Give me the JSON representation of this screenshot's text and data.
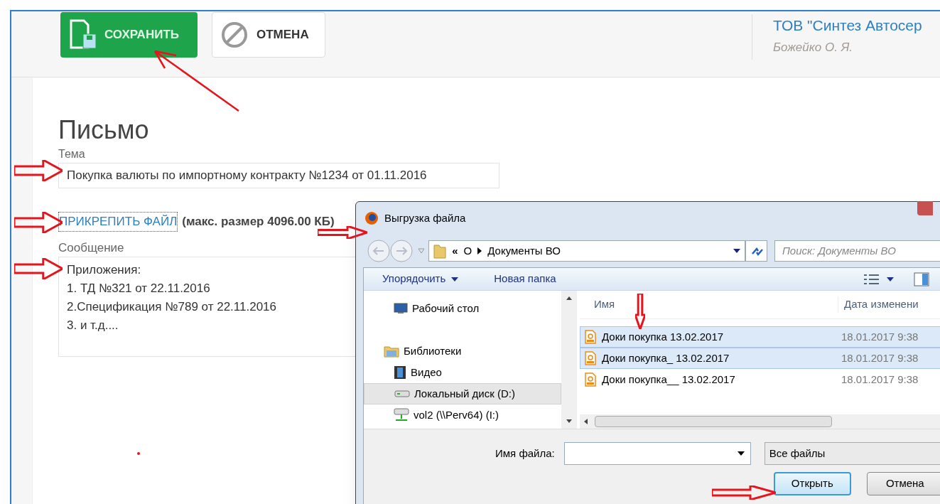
{
  "toolbar": {
    "buttons": [
      {
        "kind": "save",
        "label": "СОХРАНИТЬ"
      },
      {
        "kind": "cancel",
        "label": "ОТМЕНА"
      }
    ]
  },
  "account": {
    "company": "ТОВ \"Синтез Автосер",
    "user": "Божейко О. Я."
  },
  "form": {
    "title": "Письмо",
    "subject_label": "Тема",
    "subject_value": "Покупка валюты по импортному контракту №1234 от 01.11.2016",
    "attach_link": "ПРИКРЕПИТЬ ФАЙЛ",
    "attach_note": "(макс. размер 4096.00 КБ)",
    "message_label": "Сообщение",
    "message_lines": [
      "Приложения:",
      "1. ТД №321 от 22.11.2016",
      "2.Спецификация №789 от 22.11.2016",
      "3. и т.д...."
    ]
  },
  "dialog": {
    "title": "Выгрузка файла",
    "path": [
      "«",
      "О",
      "Документы ВО"
    ],
    "search_placeholder": "Поиск: Документы ВО",
    "commands": [
      "Упорядочить",
      "Новая папка"
    ],
    "nav_items": [
      {
        "kind": "desktop",
        "label": "Рабочий стол",
        "selected": false
      },
      {
        "kind": "library",
        "label": "Библиотеки",
        "selected": false
      },
      {
        "kind": "video",
        "label": "Видео",
        "selected": false
      },
      {
        "kind": "disk",
        "label": "Локальный диск (D:)",
        "selected": true
      },
      {
        "kind": "network",
        "label": "vol2 (\\\\Perv64) (I:)",
        "selected": false
      }
    ],
    "columns": [
      "Имя",
      "Дата изменени"
    ],
    "files": [
      {
        "name": "Доки покупка 13.02.2017",
        "date": "18.01.2017 9:38",
        "selected": true
      },
      {
        "name": "Доки покупка_ 13.02.2017",
        "date": "18.01.2017 9:38",
        "selected": true
      },
      {
        "name": "Доки покупка__ 13.02.2017",
        "date": "18.01.2017 9:38",
        "selected": false
      }
    ],
    "filename_label": "Имя файла:",
    "filetype": "Все файлы",
    "buttons": [
      "Открыть",
      "Отмена"
    ]
  }
}
